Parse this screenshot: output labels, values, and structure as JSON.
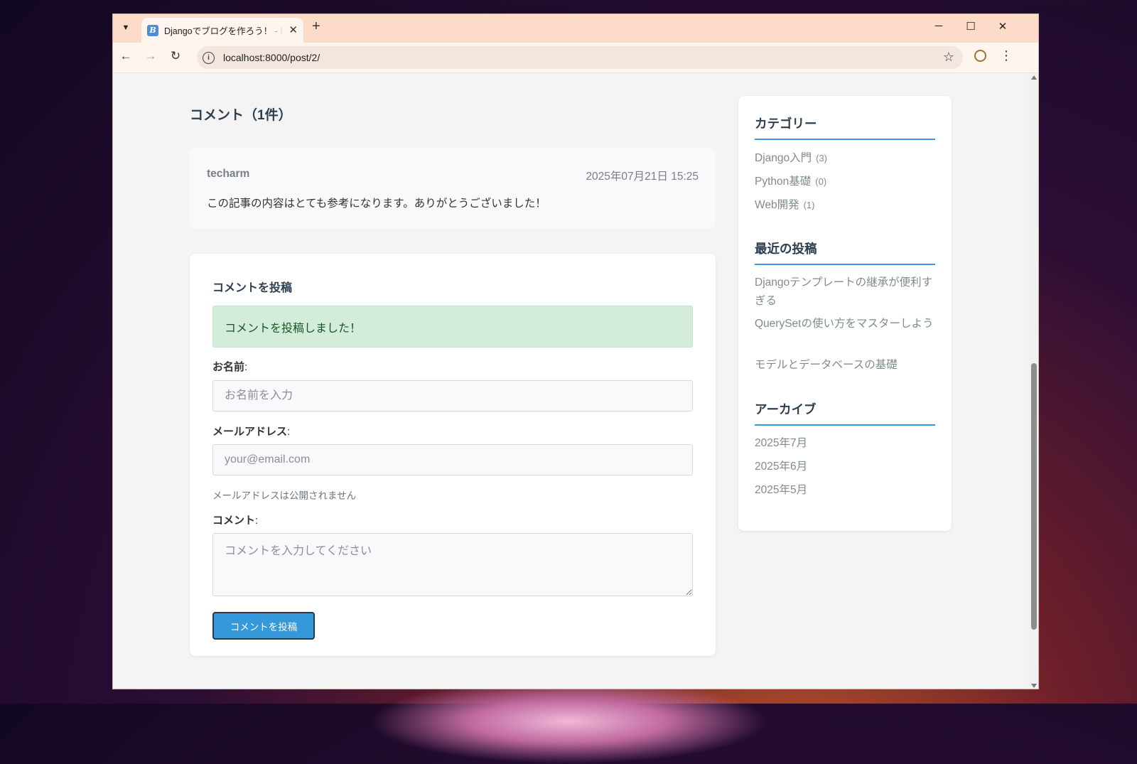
{
  "browser": {
    "tab_title": "Djangoでブログを作ろう！ - My Blog",
    "favicon_letter": "B",
    "url": "localhost:8000/post/2/",
    "icons": {
      "tab_search": "chevron-down-icon",
      "tab_close": "close-icon",
      "new_tab": "plus-icon",
      "minimize": "minimize-icon",
      "maximize": "maximize-icon",
      "close": "close-icon",
      "back": "arrow-left-icon",
      "forward": "arrow-right-icon",
      "reload": "reload-icon",
      "site_info": "info-icon",
      "bookmark": "star-icon",
      "profile": "profile-icon",
      "menu": "kebab-menu-icon"
    }
  },
  "comments": {
    "heading": "コメント（1件）",
    "items": [
      {
        "author": "techarm",
        "date": "2025年07月21日 15:25",
        "body": "この記事の内容はとても参考になります。ありがとうございました！"
      }
    ]
  },
  "comment_form": {
    "title": "コメントを投稿",
    "success_message": "コメントを投稿しました！",
    "name_label": "お名前",
    "name_placeholder": "お名前を入力",
    "email_label": "メールアドレス",
    "email_placeholder": "your@email.com",
    "email_help": "メールアドレスは公開されません",
    "comment_label": "コメント",
    "comment_placeholder": "コメントを入力してください",
    "submit_label": "コメントを投稿",
    "colon": ":"
  },
  "sidebar": {
    "categories": {
      "title": "カテゴリー",
      "items": [
        {
          "name": "Django入門",
          "count": "(3)"
        },
        {
          "name": "Python基礎",
          "count": "(0)"
        },
        {
          "name": "Web開発",
          "count": "(1)"
        }
      ]
    },
    "recent_posts": {
      "title": "最近の投稿",
      "items": [
        "Djangoテンプレートの継承が便利すぎる",
        "QuerySetの使い方をマスターしよう",
        "モデルとデータベースの基礎"
      ]
    },
    "archives": {
      "title": "アーカイブ",
      "items": [
        "2025年7月",
        "2025年6月",
        "2025年5月"
      ]
    }
  },
  "colors": {
    "accent": "#3498db",
    "heading": "#2c3e50",
    "success_bg": "#d4edda",
    "tab_strip": "#fcdcc8"
  }
}
